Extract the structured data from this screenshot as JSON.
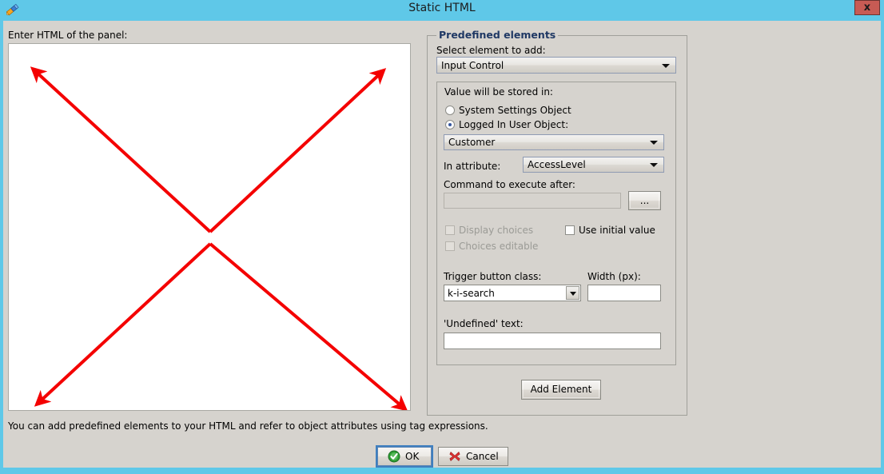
{
  "window": {
    "title": "Static HTML",
    "app_icon": "pen-diagonal-icon",
    "close_label": "x",
    "titlebar_color": "#5fc8e8",
    "close_button_color": "#c75b54",
    "client_background": "#d6d3ce"
  },
  "left_panel": {
    "html_label": "Enter HTML of the panel:",
    "html_value": "",
    "hint": "You can add predefined elements to your HTML and refer to object attributes using tag expressions.",
    "annotation": {
      "shape": "x-cross-double-arrow",
      "color": "#f40000",
      "stroke_width": 4
    }
  },
  "predefined": {
    "group_title": "Predefined elements",
    "group_title_color": "#1f3864",
    "select_element_label": "Select element to add:",
    "select_element_value": "Input Control",
    "stored_in": {
      "label": "Value will be stored in:",
      "options": [
        {
          "label": "System Settings Object",
          "selected": false
        },
        {
          "label": "Logged In User Object:",
          "selected": true
        }
      ],
      "object_value": "Customer"
    },
    "attribute": {
      "label": "In attribute:",
      "value": "AccessLevel"
    },
    "command": {
      "label": "Command to execute after:",
      "value": "",
      "browse_label": "...",
      "disabled": true
    },
    "checkboxes": [
      {
        "label": "Display choices",
        "checked": false,
        "disabled": true
      },
      {
        "label": "Choices editable",
        "checked": false,
        "disabled": true
      },
      {
        "label": "Use initial value",
        "checked": false,
        "disabled": false
      }
    ],
    "trigger_button_class": {
      "label": "Trigger button class:",
      "value": "k-i-search"
    },
    "width": {
      "label": "Width (px):",
      "value": ""
    },
    "undefined_text": {
      "label": "'Undefined' text:",
      "value": ""
    },
    "add_element_label": "Add Element"
  },
  "footer": {
    "ok_label": "OK",
    "ok_icon": "green-check-circle-icon",
    "cancel_label": "Cancel",
    "cancel_icon": "red-x-icon"
  }
}
